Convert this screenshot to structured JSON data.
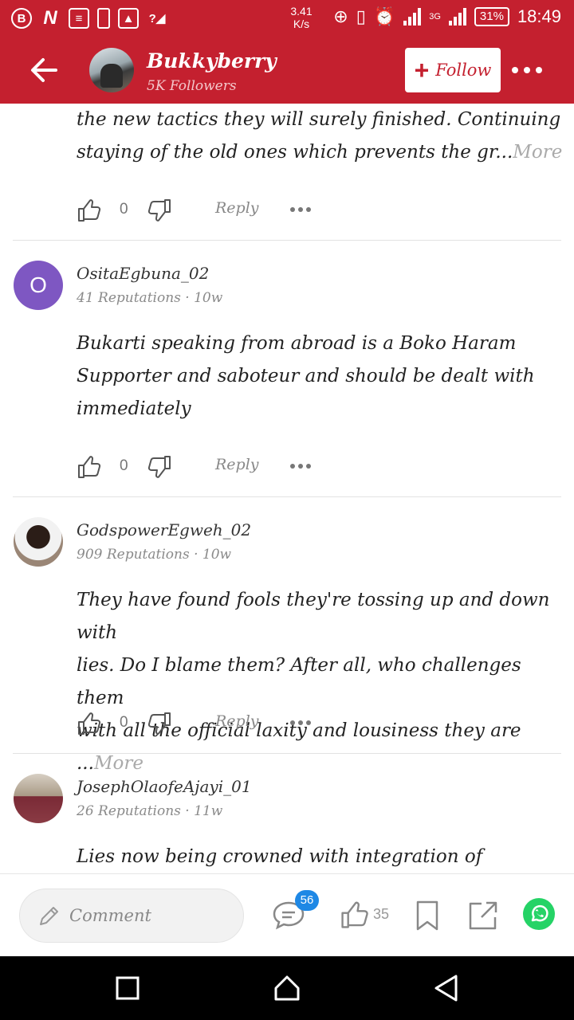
{
  "status_bar": {
    "speed": "3.41",
    "speed_unit": "K/s",
    "network": "3G",
    "battery": "31%",
    "time": "18:49"
  },
  "header": {
    "author_name": "Bukkyberry",
    "followers": "5K Followers",
    "follow_label": "Follow"
  },
  "comments": [
    {
      "text_lines": [
        "the new tactics  they  will  surely  finished.  Continuing",
        "staying  of the old  ones  which  prevents  the  gr..."
      ],
      "more": "More",
      "likes": "0",
      "reply_label": "Reply"
    },
    {
      "initial": "O",
      "name": "OsitaEgbuna_02",
      "meta": "41 Reputations · 10w",
      "text_lines": [
        "Bukarti speaking from abroad is a Boko Haram",
        "Supporter and saboteur and should be dealt with",
        "immediately"
      ],
      "likes": "0",
      "reply_label": "Reply"
    },
    {
      "name": "GodspowerEgweh_02",
      "meta": "909 Reputations · 10w",
      "text_lines": [
        "They have found fools they're tossing up and down with",
        "lies. Do I blame them? After all, who challenges them",
        "with all the official laxity and lousiness they are ..."
      ],
      "more": "More",
      "likes": "0",
      "reply_label": "Reply"
    },
    {
      "name": "JosephOlaofeAjayi_01",
      "meta": "26 Reputations · 11w",
      "text_lines": [
        "Lies now being crowned with integration of insurgency"
      ]
    }
  ],
  "bottom_bar": {
    "comment_placeholder": "Comment",
    "comment_count": "56",
    "like_count": "35"
  },
  "colors": {
    "brand_red": "#c4202f",
    "badge_blue": "#1e88e5",
    "whatsapp_green": "#25d366"
  },
  "icons": [
    "back-arrow-icon",
    "thumbs-up-icon",
    "thumbs-down-icon",
    "more-dots-icon",
    "pencil-icon",
    "comment-bubble-icon",
    "bookmark-icon",
    "share-icon",
    "whatsapp-icon",
    "recent-apps-icon",
    "home-icon",
    "back-triangle-icon"
  ]
}
